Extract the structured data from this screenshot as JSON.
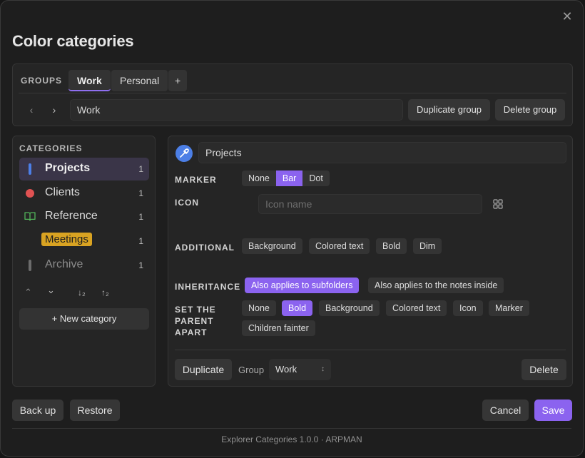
{
  "dialog": {
    "title": "Color categories",
    "close_glyph": "✕"
  },
  "groups": {
    "label": "GROUPS",
    "tabs": [
      {
        "label": "Work",
        "active": true
      },
      {
        "label": "Personal",
        "active": false
      }
    ],
    "add_label": "+",
    "current_name": "Work",
    "duplicate_label": "Duplicate group",
    "delete_label": "Delete group"
  },
  "categories": {
    "label": "CATEGORIES",
    "items": [
      {
        "name": "Projects",
        "count": "1",
        "marker": "bar",
        "color": "#4c7fe6"
      },
      {
        "name": "Clients",
        "count": "1",
        "marker": "dot",
        "color": "#e05252"
      },
      {
        "name": "Reference",
        "count": "1",
        "marker": "book-icon",
        "color": "#52b55a"
      },
      {
        "name": "Meetings",
        "count": "1",
        "marker": "none",
        "color": "#d9a322"
      },
      {
        "name": "Archive",
        "count": "1",
        "marker": "bar",
        "color": "#777777"
      }
    ],
    "new_label": "+ New category"
  },
  "editor": {
    "category_name": "Projects",
    "marker": {
      "label": "MARKER",
      "options": [
        "None",
        "Bar",
        "Dot"
      ],
      "selected": "Bar"
    },
    "icon": {
      "label": "ICON",
      "placeholder": "Icon name"
    },
    "additional": {
      "label": "ADDITIONAL",
      "options": [
        "Background",
        "Colored text",
        "Bold",
        "Dim"
      ]
    },
    "inheritance": {
      "label": "INHERITANCE",
      "options": [
        "Also applies to subfolders",
        "Also applies to the notes inside"
      ],
      "selected": "Also applies to subfolders"
    },
    "parent_apart": {
      "label": "SET THE PARENT APART",
      "options": [
        "None",
        "Bold",
        "Background",
        "Colored text",
        "Icon",
        "Marker",
        "Children fainter"
      ],
      "selected": "Bold"
    },
    "duplicate_label": "Duplicate",
    "group_label": "Group",
    "group_value": "Work",
    "delete_label": "Delete"
  },
  "actions": {
    "backup": "Back up",
    "restore": "Restore",
    "cancel": "Cancel",
    "save": "Save"
  },
  "footer": "Explorer Categories 1.0.0 · ARPMAN"
}
